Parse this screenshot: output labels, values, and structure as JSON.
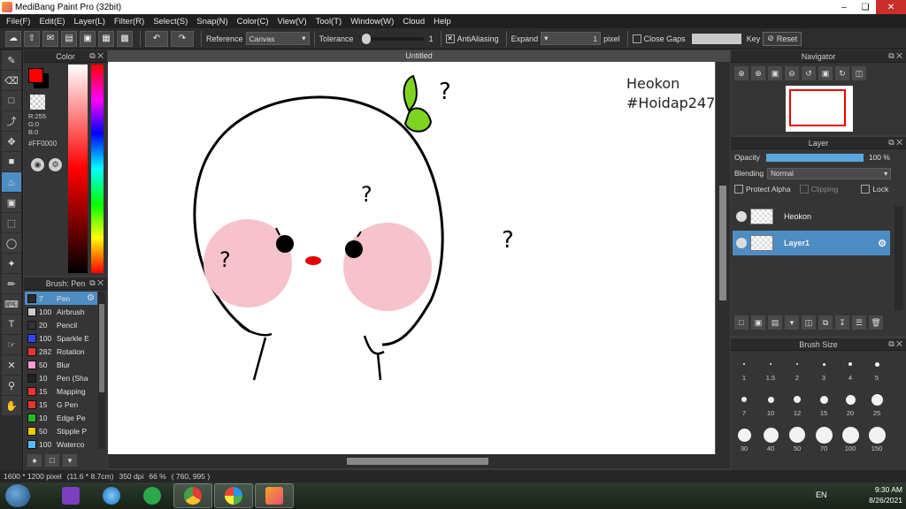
{
  "window": {
    "title": "MediBang Paint Pro (32bit)"
  },
  "menu": [
    "File(F)",
    "Edit(E)",
    "Layer(L)",
    "Filter(R)",
    "Select(S)",
    "Snap(N)",
    "Color(C)",
    "View(V)",
    "Tool(T)",
    "Window(W)",
    "Cloud",
    "Help"
  ],
  "toolbar": {
    "reference_label": "Reference",
    "reference_value": "Canvas",
    "tolerance_label": "Tolerance",
    "tolerance_value": "1",
    "antialiasing_label": "AntiAliasing",
    "antialiasing_checked": true,
    "expand_label": "Expand",
    "expand_value": "1",
    "expand_unit": "pixel",
    "close_gaps_label": "Close Gaps",
    "close_gaps_checked": false,
    "key_label": "Key",
    "reset_label": "Reset"
  },
  "color_panel": {
    "title": "Color",
    "foreground": "#ff0000",
    "background": "#000000",
    "r": "R:255",
    "g": "G:0",
    "b": "B:0",
    "hex": "#FF0000"
  },
  "brush_panel": {
    "title": "Brush: Pen",
    "items": [
      {
        "size": "7",
        "name": "Pen",
        "color": "#2a2a2a",
        "selected": true
      },
      {
        "size": "100",
        "name": "Airbrush",
        "color": "#cccccc"
      },
      {
        "size": "20",
        "name": "Pencil",
        "color": "#333333"
      },
      {
        "size": "100",
        "name": "Sparkle E",
        "color": "#3344ff"
      },
      {
        "size": "282",
        "name": "Rotation",
        "color": "#ee3333"
      },
      {
        "size": "50",
        "name": "Blur",
        "color": "#ff99dd"
      },
      {
        "size": "10",
        "name": "Pen (Sha",
        "color": "#222222"
      },
      {
        "size": "15",
        "name": "Mapping",
        "color": "#ee3333"
      },
      {
        "size": "15",
        "name": "G Pen",
        "color": "#ee3333"
      },
      {
        "size": "10",
        "name": "Edge Pe",
        "color": "#22bb22"
      },
      {
        "size": "50",
        "name": "Stipple P",
        "color": "#eecc00"
      },
      {
        "size": "100",
        "name": "Waterco",
        "color": "#55bbff"
      }
    ]
  },
  "document": {
    "tab_title": "Untitled",
    "watermark_line1": "Heokon",
    "watermark_line2": "#Hoidap247"
  },
  "navigator": {
    "title": "Navigator"
  },
  "layer_panel": {
    "title": "Layer",
    "opacity_label": "Opacity",
    "opacity_value": "100 %",
    "opacity_fraction": 1.0,
    "blending_label": "Blending",
    "blending_value": "Normal",
    "protect_alpha_label": "Protect Alpha",
    "clipping_label": "Clipping",
    "lock_label": "Lock",
    "layers": [
      {
        "name": "Heokon",
        "selected": false
      },
      {
        "name": "Layer1",
        "selected": true
      }
    ]
  },
  "brush_size_panel": {
    "title": "Brush Size",
    "sizes": [
      "1",
      "1.5",
      "2",
      "3",
      "4",
      "5",
      "7",
      "10",
      "12",
      "15",
      "20",
      "25",
      "30",
      "40",
      "50",
      "70",
      "100",
      "150"
    ]
  },
  "status": {
    "dimensions": "1600 * 1200 pixel",
    "physical": "(11.6 * 8.7cm)",
    "dpi": "350 dpi",
    "zoom": "66 %",
    "cursor": "( 760, 995 )"
  },
  "taskbar": {
    "language": "EN",
    "time": "9:30 AM",
    "date": "8/26/2021"
  }
}
